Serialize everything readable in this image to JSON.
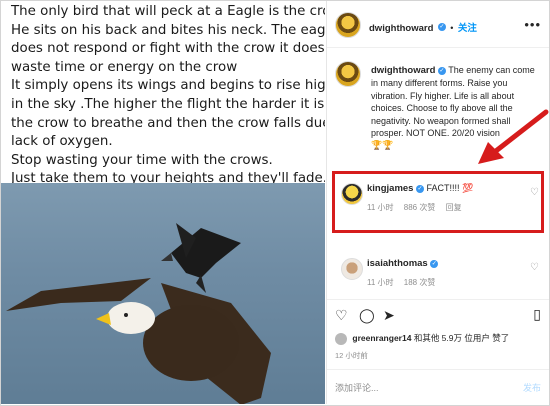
{
  "post": {
    "text_lines": [
      "The only bird that will peck at a Eagle is the crow.",
      "He sits on his back and bites his neck. The eagle",
      "does not respond or fight with the crow it doesn't",
      "waste time or energy on the crow",
      "It simply opens its wings and begins to rise higher",
      "in the sky .The higher the flight the harder it is for",
      "the crow to breathe and then the crow falls due to",
      "lack of oxygen.",
      "Stop wasting your time with the crows.",
      "Just take them to your heights and they'll fade."
    ]
  },
  "header": {
    "username": "dwighthoward",
    "separator": "•",
    "follow_label": "关注",
    "more_label": "•••"
  },
  "caption": {
    "username": "dwighthoward",
    "text": "The enemy can come in many different forms. Raise you vibration. Fly higher. Life is all about choices. Choose to fly above all the negativity. No weapon formed shall prosper. NOT ONE. 20/20 vision",
    "trophies": "🏆🏆"
  },
  "comments": [
    {
      "username": "kingjames",
      "text": "FACT!!!! 💯",
      "time": "11 小时",
      "likes": "886 次赞",
      "reply": "回复"
    },
    {
      "username": "isaiahthomas",
      "text": "",
      "time": "11 小时",
      "likes": "188 次赞",
      "reply": ""
    }
  ],
  "likes": {
    "user": "greenranger14",
    "text": "和其他 5.9万 位用户 赞了"
  },
  "timestamp": "12 小时前",
  "add_comment": {
    "placeholder": "添加评论...",
    "publish": "发布"
  },
  "colors": {
    "highlight_box": "#d61c1c",
    "verified": "#3897f0",
    "link": "#0095f6"
  }
}
